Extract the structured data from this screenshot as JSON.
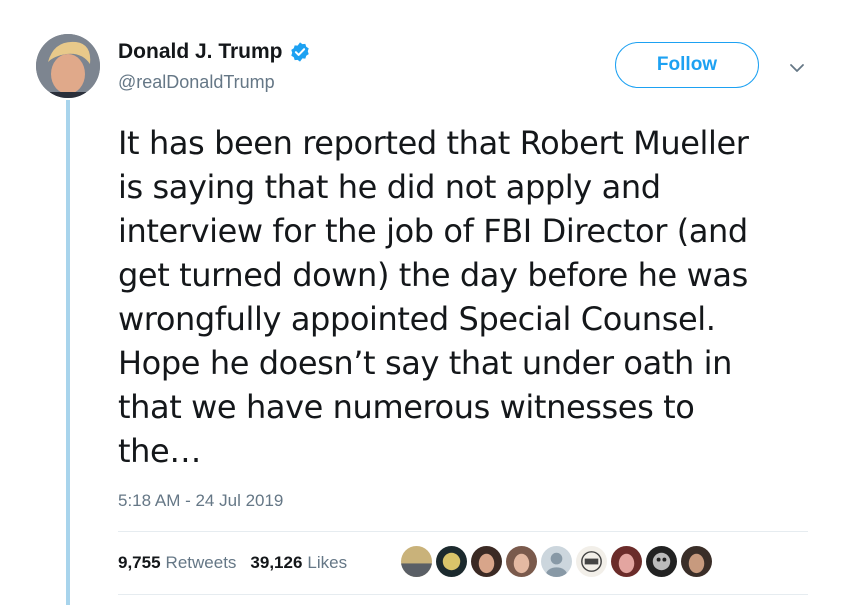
{
  "author": {
    "display_name": "Donald J. Trump",
    "handle": "@realDonaldTrump",
    "verified": true
  },
  "follow_label": "Follow",
  "tweet": {
    "text": "It has been reported that Robert Mueller\nis saying that he did not apply and\ninterview for the job of FBI Director (and\nget turned down) the day before he was\nwrongfully appointed Special Counsel.\nHope he doesn’t say that under oath in\nthat we have numerous witnesses to\nthe…",
    "timestamp": "5:18 AM - 24 Jul 2019"
  },
  "stats": {
    "retweets_count": "9,755",
    "retweets_label": "Retweets",
    "likes_count": "39,126",
    "likes_label": "Likes"
  },
  "likers": [
    {
      "icon": "liker-avatar-1"
    },
    {
      "icon": "liker-avatar-2"
    },
    {
      "icon": "liker-avatar-3"
    },
    {
      "icon": "liker-avatar-4"
    },
    {
      "icon": "liker-avatar-5"
    },
    {
      "icon": "liker-avatar-6"
    },
    {
      "icon": "liker-avatar-7"
    },
    {
      "icon": "liker-avatar-8"
    },
    {
      "icon": "liker-avatar-9"
    }
  ],
  "colors": {
    "accent": "#1da1f2",
    "thread_line": "#a8d4ec",
    "secondary_text": "#657786"
  }
}
